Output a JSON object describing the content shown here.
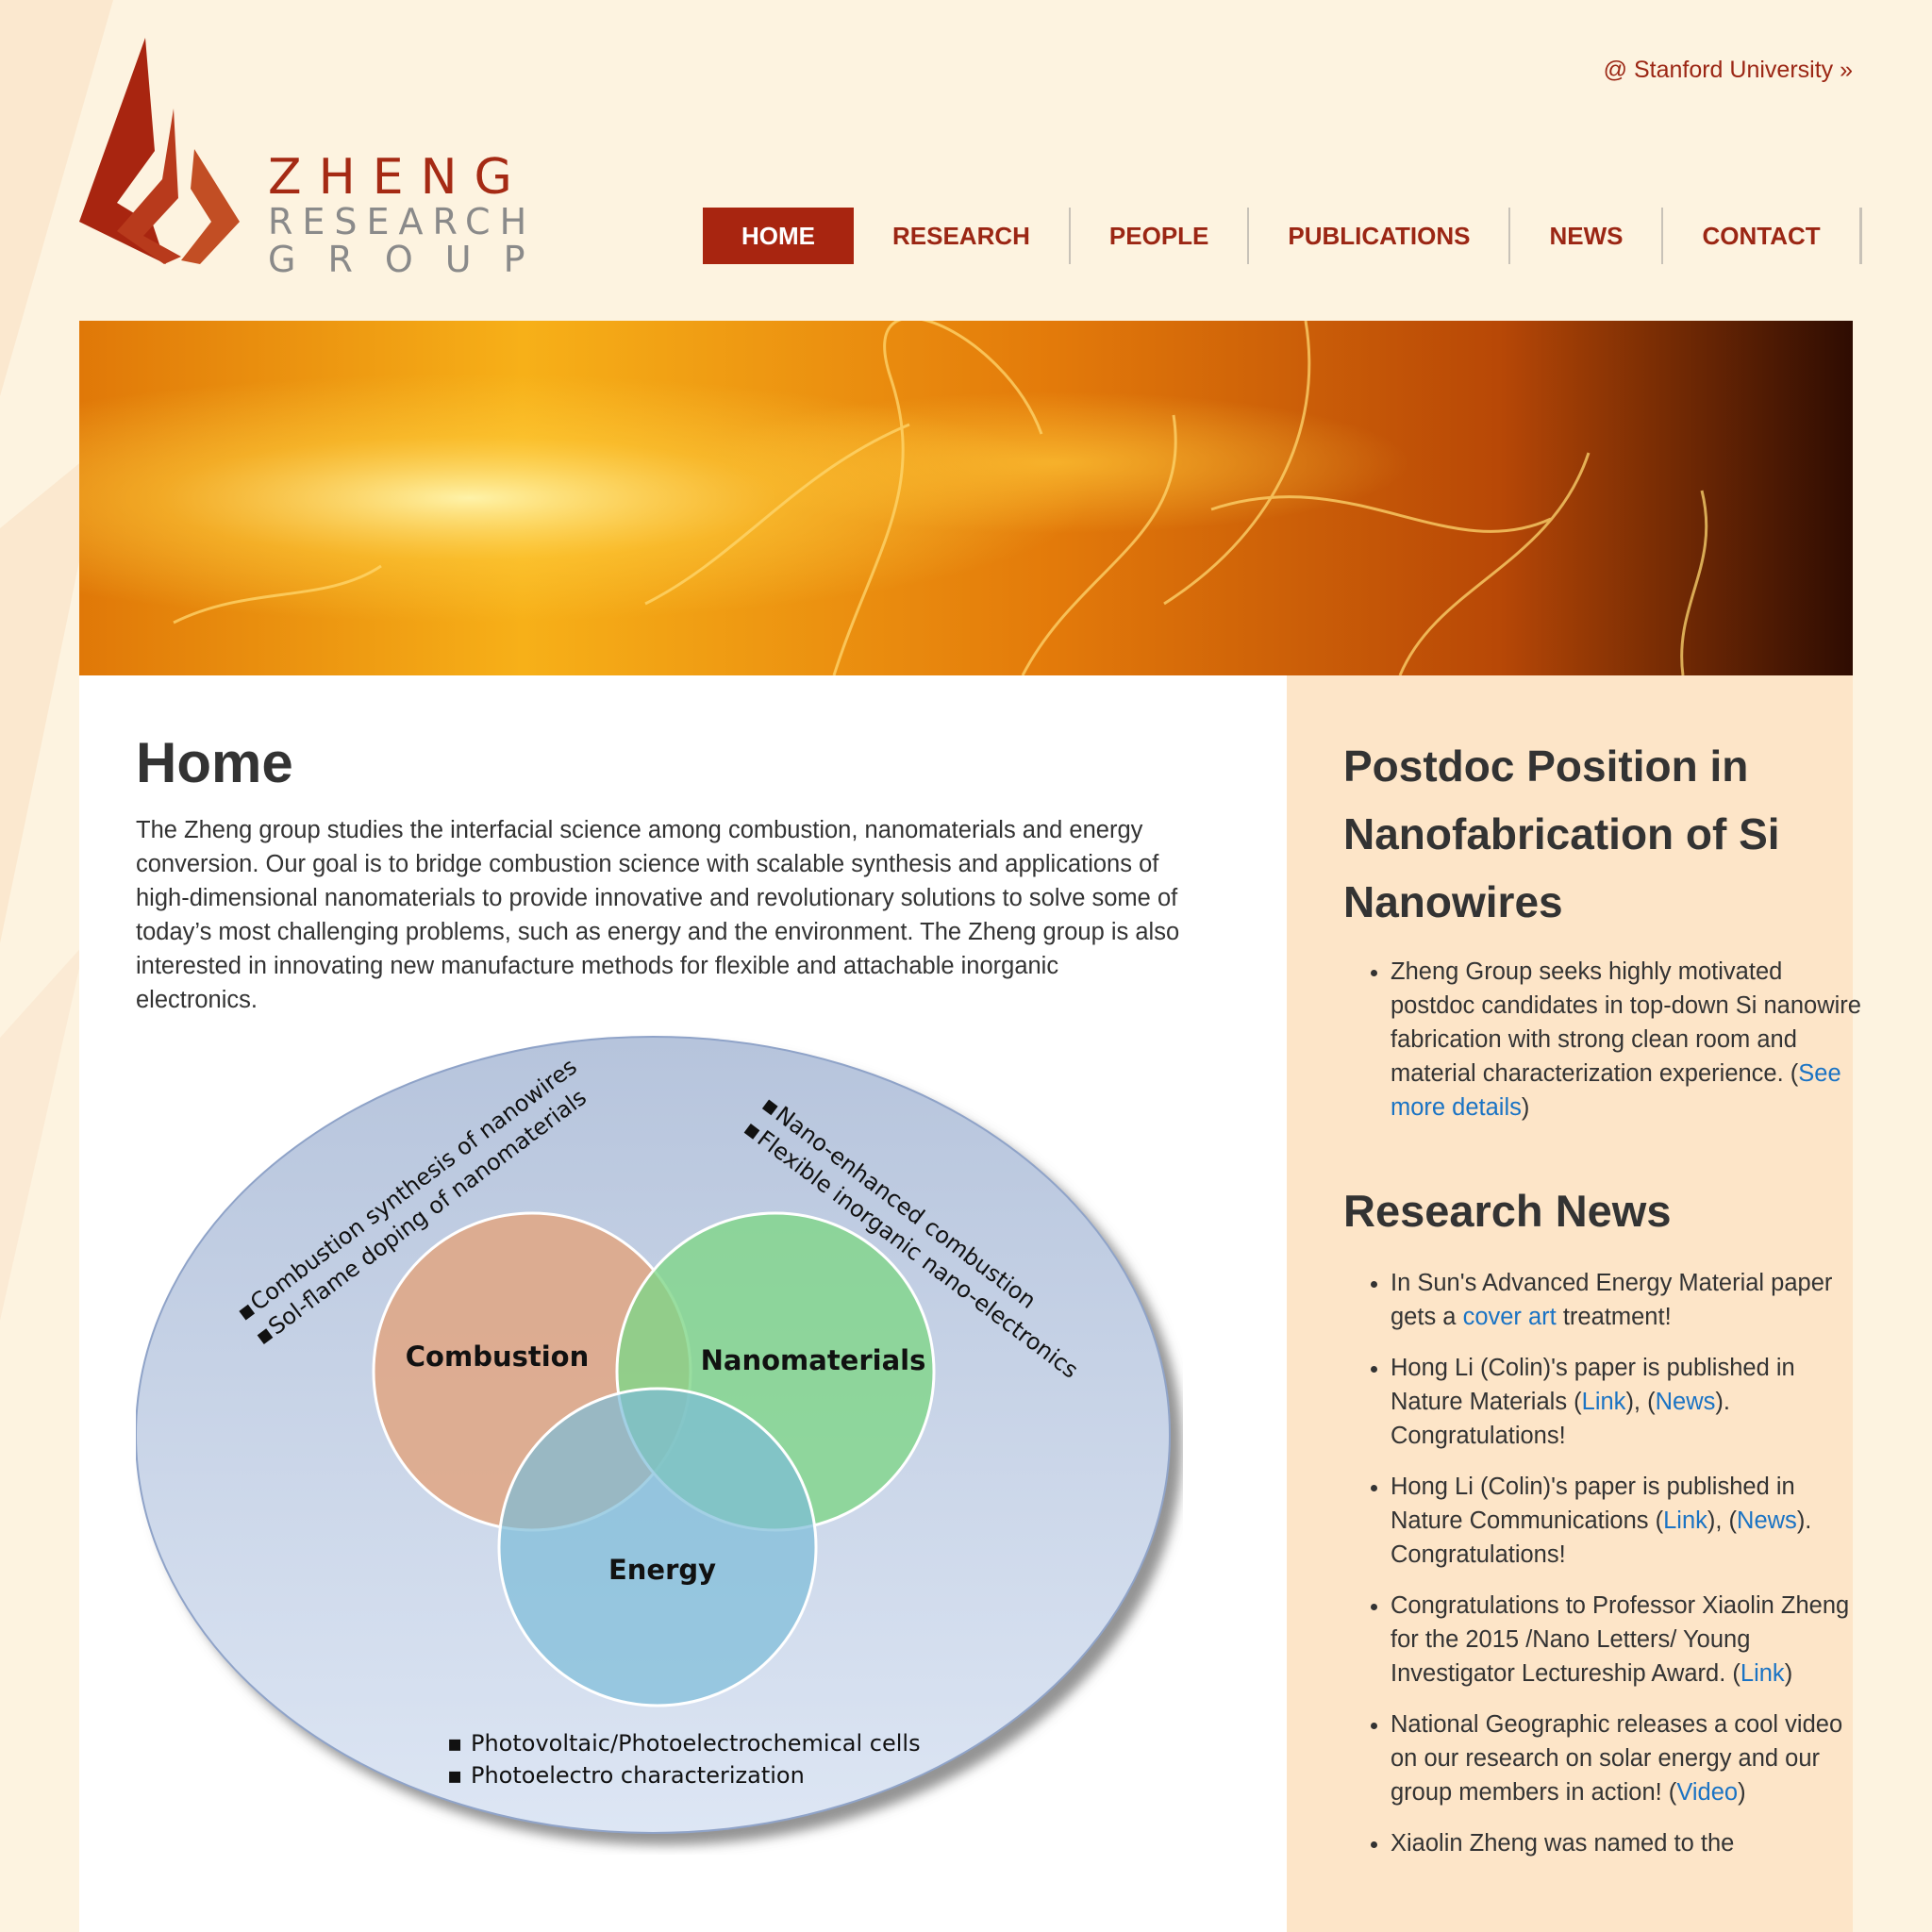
{
  "header": {
    "stanford_link": "@ Stanford University »",
    "logo": {
      "line1": "ZHENG",
      "line2": "RESEARCH",
      "line3": "GROUP"
    }
  },
  "nav": {
    "items": [
      "HOME",
      "RESEARCH",
      "PEOPLE",
      "PUBLICATIONS",
      "NEWS",
      "CONTACT"
    ],
    "active": "HOME"
  },
  "main": {
    "title": "Home",
    "intro": "The Zheng group studies the interfacial science among combustion, nanomaterials and energy conversion. Our goal is to bridge combustion science with scalable synthesis and applications of high-dimensional nanomaterials to provide innovative and revolutionary solutions to solve some of today’s most challenging problems, such as energy and the environment. The Zheng group is also interested in innovating new manufacture methods for flexible and attachable inorganic electronics.",
    "diagram": {
      "circles": [
        "Combustion",
        "Nanomaterials",
        "Energy"
      ],
      "left_notes": [
        "Combustion synthesis of nanowires",
        "Sol-flame doping of nanomaterials"
      ],
      "right_notes": [
        "Nano-enhanced combustion",
        "Flexible inorganic nano-electronics"
      ],
      "bottom_notes": [
        "Photovoltaic/Photoelectrochemical cells",
        "Photoelectro characterization"
      ],
      "colors": {
        "combustion": "#e0a682",
        "nanomaterials": "#80d688",
        "energy": "#7cbcd8",
        "ellipse": "#b8c6df"
      }
    }
  },
  "sidebar": {
    "position_title": "Postdoc Position in Nanofabrication of Si Nanowires",
    "position_item": {
      "text": "Zheng Group seeks highly motivated postdoc candidates in top-down Si nanowire fabrication with strong clean room and material characterization experience. (",
      "link": "See more details",
      "after": ")"
    },
    "news_title": "Research News",
    "news": [
      {
        "before": "In Sun's Advanced Energy Material paper gets a ",
        "link1": "cover art",
        "mid": " treatment!",
        "link2": "",
        "after": ""
      },
      {
        "before": "Hong Li (Colin)'s paper is published in Nature Materials (",
        "link1": "Link",
        "mid": "), (",
        "link2": "News",
        "after": "). Congratulations!"
      },
      {
        "before": "Hong Li (Colin)'s paper is published in Nature Communications (",
        "link1": "Link",
        "mid": "), (",
        "link2": "News",
        "after": "). Congratulations!"
      },
      {
        "before": "Congratulations to Professor Xiaolin Zheng for the 2015 /Nano Letters/ Young Investigator Lectureship Award. (",
        "link1": "Link",
        "mid": ")",
        "link2": "",
        "after": ""
      },
      {
        "before": "National Geographic releases a cool video on our research on solar energy and our group members in action! (",
        "link1": "Video",
        "mid": ")",
        "link2": "",
        "after": ""
      },
      {
        "before": "Xiaolin Zheng was named to the",
        "link1": "",
        "mid": "",
        "link2": "",
        "after": ""
      }
    ]
  },
  "colors": {
    "brand": "#a82510",
    "link": "#1a73c4",
    "sidebar_bg": "#fde5c8",
    "page_bg": "#fdf3e0"
  }
}
